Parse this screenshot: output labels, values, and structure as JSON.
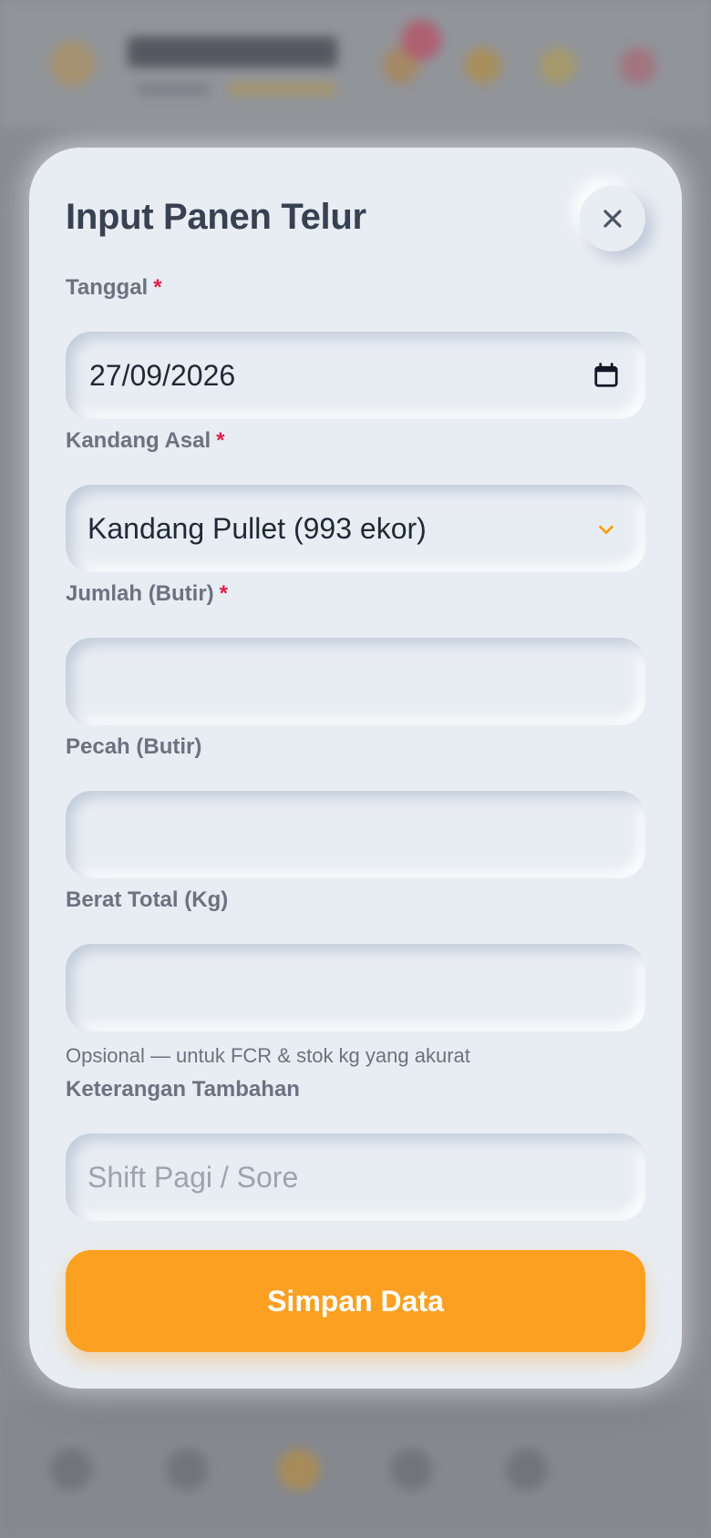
{
  "modal": {
    "title": "Input Panen Telur",
    "close_icon": "close-icon",
    "submit_label": "Simpan Data"
  },
  "fields": {
    "tanggal": {
      "label": "Tanggal",
      "required_mark": "*",
      "value": "27/09/2026",
      "icon": "calendar-icon"
    },
    "kandang": {
      "label": "Kandang Asal",
      "required_mark": "*",
      "value": "Kandang Pullet (993 ekor)",
      "icon": "chevron-down-icon"
    },
    "jumlah": {
      "label": "Jumlah (Butir)",
      "required_mark": "*",
      "value": "",
      "placeholder": ""
    },
    "pecah": {
      "label": "Pecah (Butir)",
      "value": "",
      "placeholder": ""
    },
    "berat": {
      "label": "Berat Total (Kg)",
      "value": "",
      "placeholder": "",
      "hint": "Opsional — untuk FCR & stok kg yang akurat"
    },
    "keterangan": {
      "label": "Keterangan Tambahan",
      "value": "",
      "placeholder": "Shift Pagi / Sore"
    }
  },
  "colors": {
    "accent": "#fba021",
    "required": "#e11d48",
    "surface": "#e8edf3",
    "title": "#374151"
  }
}
